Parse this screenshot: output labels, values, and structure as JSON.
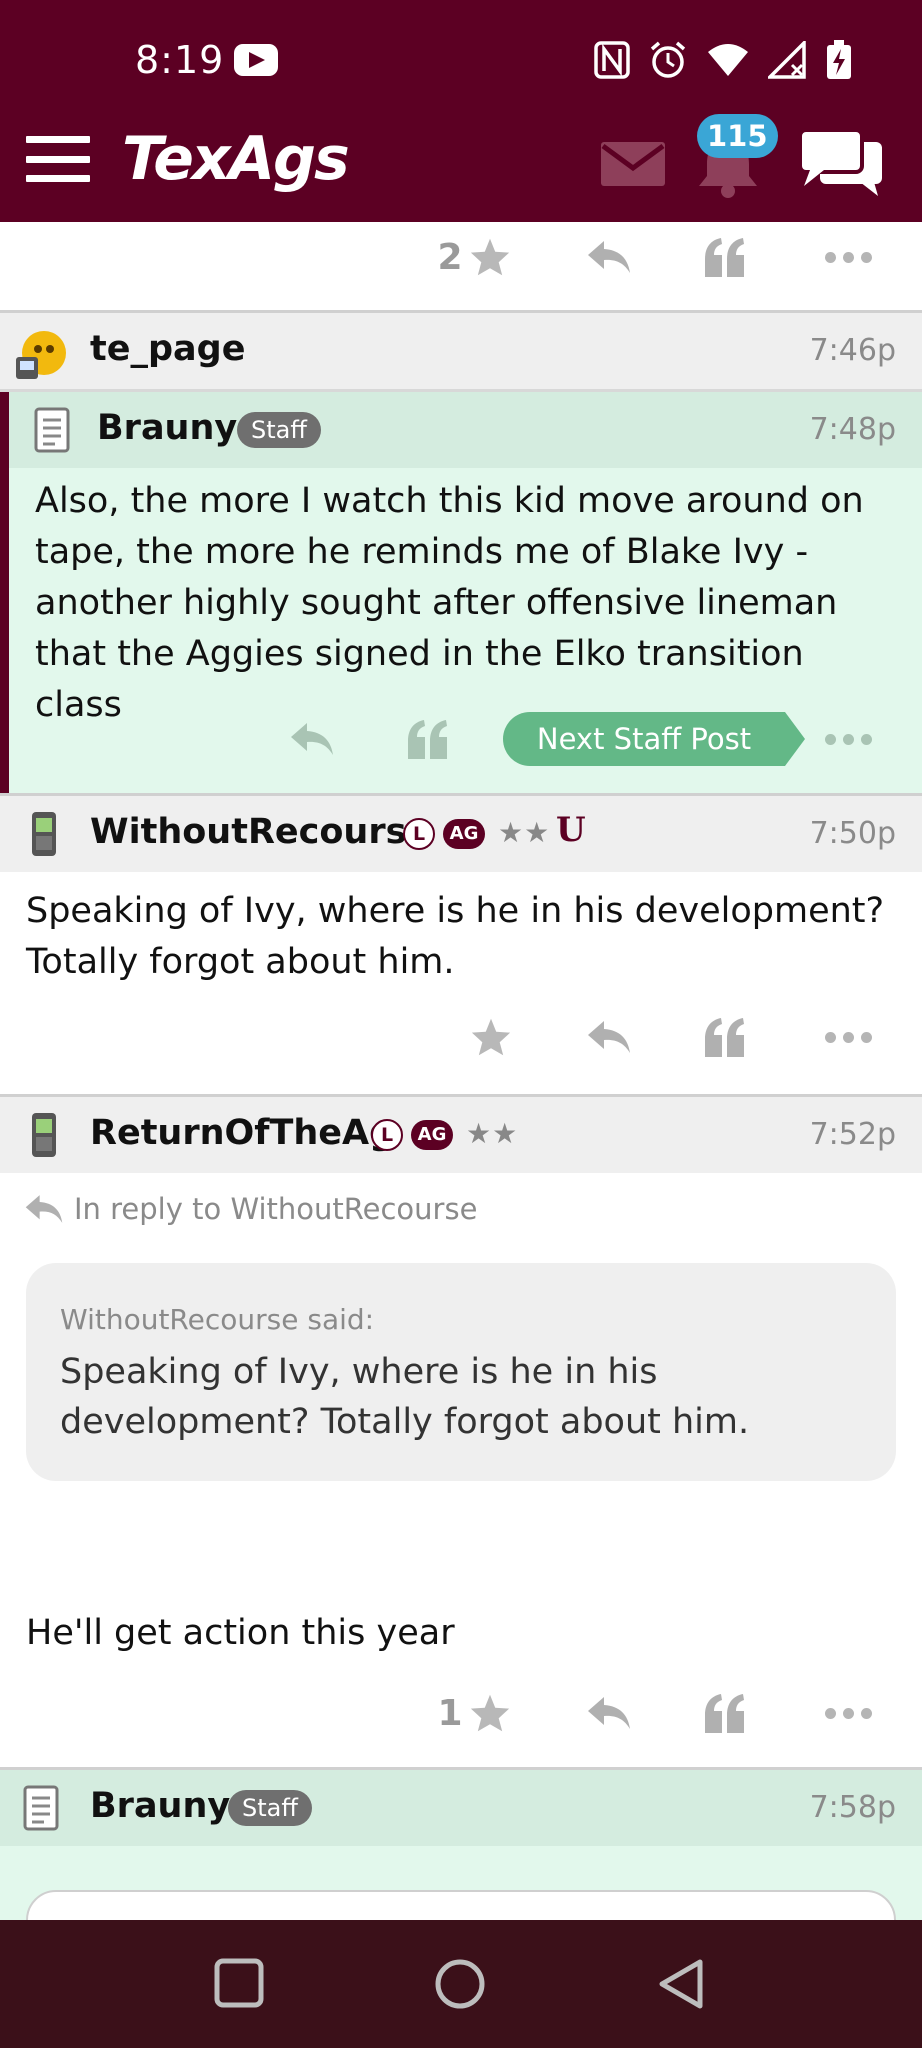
{
  "status_bar": {
    "time": "8:19",
    "icons": [
      "youtube-icon",
      "nfc-icon",
      "alarm-icon",
      "wifi-icon",
      "signal-icon",
      "battery-charging-icon"
    ]
  },
  "header": {
    "logo": "TexAgs",
    "notification_count": "115",
    "colors": {
      "brand": "#5c0023",
      "badge": "#3aa6d6"
    }
  },
  "top_post_actions": {
    "star_count": "2"
  },
  "posts": [
    {
      "author": "te_page",
      "time": "7:46p"
    },
    {
      "author": "Brauny",
      "tag": "Staff",
      "time": "7:48p",
      "text": "Also, the more I watch this kid move around on tape, the more he reminds me of Blake Ivy - another highly sought after offensive lineman that the Aggies signed in the Elko transition class",
      "next_staff_label": "Next Staff Post"
    },
    {
      "author": "WithoutRecourse",
      "badge_l": "L",
      "badge_ag": "AG",
      "stars": "★★",
      "badge_u": "U",
      "time": "7:50p",
      "text": "Speaking of Ivy, where is he in his development? Totally forgot about him."
    },
    {
      "author": "ReturnOfTheAg",
      "badge_l": "L",
      "badge_ag": "AG",
      "stars": "★★",
      "time": "7:52p",
      "reply_to": "In reply to WithoutRecourse",
      "quote_attr": "WithoutRecourse said:",
      "quote_text": "Speaking of Ivy, where is he in his development? Totally forgot about him.",
      "text": "He'll get action this year",
      "star_count": "1"
    },
    {
      "author": "Brauny",
      "tag": "Staff",
      "time": "7:58p"
    }
  ],
  "nav_bar": {
    "buttons": [
      "recents-button",
      "home-button",
      "back-button"
    ]
  }
}
